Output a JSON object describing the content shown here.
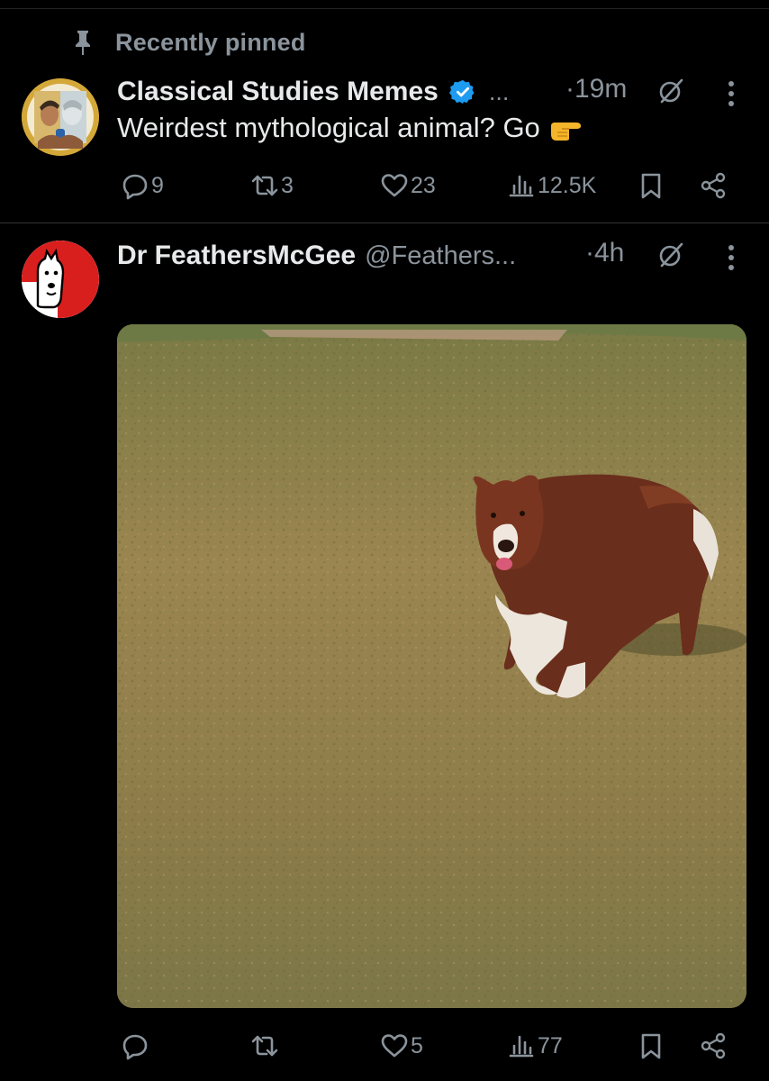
{
  "pinned": {
    "label": "Recently pinned"
  },
  "tweets": [
    {
      "name": "Classical Studies Memes",
      "ellipsis": "...",
      "time": "·19m",
      "text": "Weirdest mythological animal? Go",
      "stats": {
        "replies": "9",
        "reposts": "3",
        "likes": "23",
        "views": "12.5K"
      }
    },
    {
      "name": "Dr FeathersMcGee",
      "handle": "@Feathers...",
      "time": "·4h",
      "stats": {
        "replies": "",
        "reposts": "",
        "likes": "5",
        "views": "77"
      },
      "media": "photo of a fluffy brown and white dog walking on grass"
    }
  ],
  "colors": {
    "background": "#000000",
    "text": "#e7e9ea",
    "muted": "#8b949c",
    "verified": "#1d9bf0"
  },
  "icons": [
    "pin-icon",
    "verified-badge-icon",
    "grok-icon",
    "more-icon",
    "reply-icon",
    "repost-icon",
    "like-icon",
    "views-icon",
    "bookmark-icon",
    "share-icon",
    "pointing-emoji"
  ]
}
